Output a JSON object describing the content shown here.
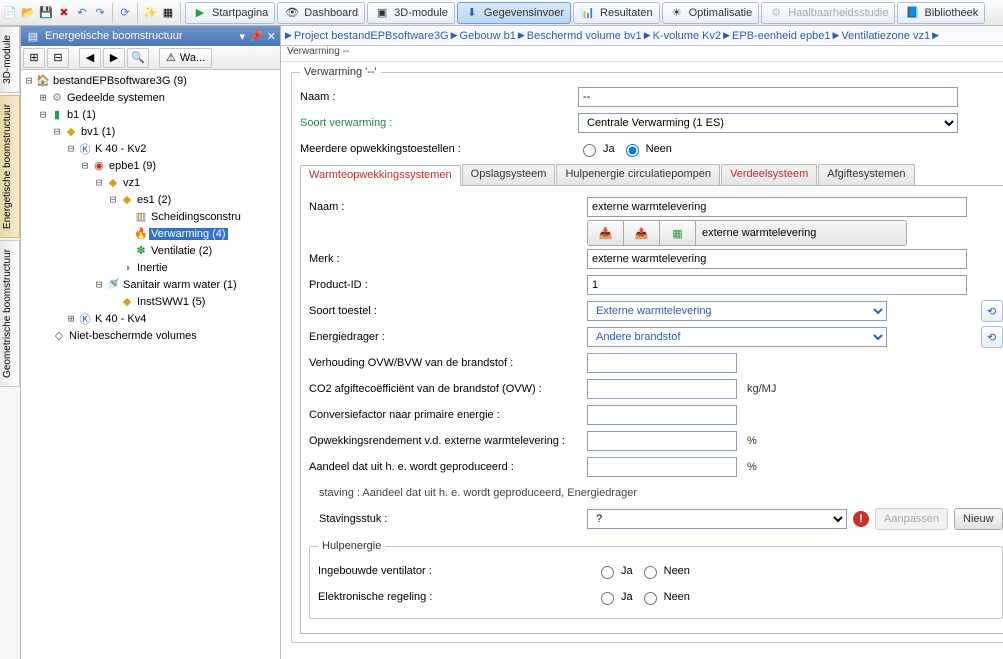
{
  "toolbar": {
    "start": "Startpagina",
    "dashboard": "Dashboard",
    "module3d": "3D-module",
    "data_entry": "Gegevensinvoer",
    "results": "Resultaten",
    "optim": "Optimalisatie",
    "feasibility": "Haalbaarheidsstudie",
    "library": "Bibliotheek"
  },
  "sidetabs": {
    "t1": "3D-module",
    "t2": "Energetische boomstructuur",
    "t3": "Geometrische boomstructuur"
  },
  "panel": {
    "title": "Energetische boomstructuur",
    "warn_btn": "Wa..."
  },
  "tree": {
    "root": "bestandEPBsoftware3G (9)",
    "shared": "Gedeelde systemen",
    "b1": "b1 (1)",
    "bv1": "bv1 (1)",
    "k40kv2": "K 40 - Kv2",
    "epbe1": "epbe1 (9)",
    "vz1": "vz1",
    "es1": "es1 (2)",
    "scheiding": "Scheidingsconstru",
    "verwarming": "Verwarming (4)",
    "ventilatie": "Ventilatie (2)",
    "inertie": "Inertie",
    "sww": "Sanitair warm water (1)",
    "instsww": "InstSWW1 (5)",
    "k40kv4": "K 40 - Kv4",
    "niet": "Niet-beschermde volumes"
  },
  "breadcrumb": {
    "p1": "Project bestandEPBsoftware3G",
    "p2": "Gebouw b1",
    "p3": "Beschermd volume bv1",
    "p4": "K-volume Kv2",
    "p5": "EPB-eenheid epbe1",
    "p6": "Ventilatiezone vz1"
  },
  "loc": "Verwarming --",
  "heating": {
    "legend": "Verwarming '--'",
    "name_lab": "Naam :",
    "name_val": "--",
    "type_lab": "Soort verwarming :",
    "type_val": "Centrale Verwarming (1 ES)",
    "multi_lab": "Meerdere opwekkingstoestellen :",
    "yes": "Ja",
    "no": "Neen"
  },
  "tabs": {
    "t1": "Warmteopwekkingssystemen",
    "t2": "Opslagsysteem",
    "t3": "Hulpenergie circulatiepompen",
    "t4": "Verdeelsysteem",
    "t5": "Afgiftesystemen"
  },
  "gen": {
    "name_lab": "Naam :",
    "name_val": "externe warmtelevering",
    "toolbar_caption": "externe warmtelevering",
    "brand_lab": "Merk :",
    "brand_val": "externe warmtelevering",
    "pid_lab": "Product-ID :",
    "pid_val": "1",
    "device_lab": "Soort toestel :",
    "device_val": "Externe warmtelevering",
    "carrier_lab": "Energiedrager :",
    "carrier_val": "Andere brandstof",
    "ratio_lab": "Verhouding OVW/BVW van de brandstof :",
    "co2_lab": "CO2 afgiftecoëfficiënt van de brandstof (OVW) :",
    "co2_unit": "kg/MJ",
    "conv_lab": "Conversiefactor naar primaire energie :",
    "eff_lab": "Opwekkingsrendement v.d. externe warmtelevering :",
    "pct": "%",
    "share_lab": "Aandeel dat uit h. e. wordt geproduceerd :",
    "staving_note": "staving : Aandeel dat uit h. e. wordt geproduceerd, Energiedrager",
    "staving_lab": "Stavingsstuk :",
    "staving_val": "?",
    "edit": "Aanpassen",
    "new": "Nieuw"
  },
  "aux": {
    "legend": "Hulpenergie",
    "fan_lab": "Ingebouwde ventilator :",
    "elec_lab": "Elektronische regeling :",
    "yes": "Ja",
    "no": "Neen"
  }
}
